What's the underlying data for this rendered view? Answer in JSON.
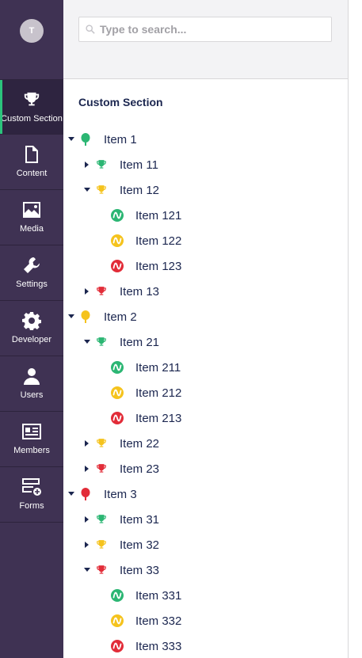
{
  "user": {
    "initial": "T"
  },
  "nav": {
    "items": [
      {
        "label": "Custom Section",
        "icon": "trophy-icon"
      },
      {
        "label": "Content",
        "icon": "document-icon"
      },
      {
        "label": "Media",
        "icon": "image-icon"
      },
      {
        "label": "Settings",
        "icon": "wrench-icon"
      },
      {
        "label": "Developer",
        "icon": "gear-icon"
      },
      {
        "label": "Users",
        "icon": "user-icon"
      },
      {
        "label": "Members",
        "icon": "id-card-icon"
      },
      {
        "label": "Forms",
        "icon": "forms-icon"
      }
    ],
    "active_index": 0
  },
  "search": {
    "placeholder": "Type to search..."
  },
  "section": {
    "title": "Custom Section"
  },
  "colors": {
    "sidebar_bg": "#3f3253",
    "accent": "#2bc37c",
    "green": "#2bb673",
    "yellow": "#f5c31d",
    "red": "#e22c38",
    "text": "#1b264f"
  },
  "tree": [
    {
      "label": "Item 1",
      "level": 0,
      "caret": "down",
      "icon": "tree-icon",
      "color": "green"
    },
    {
      "label": "Item 11",
      "level": 1,
      "caret": "right",
      "icon": "trophy-icon",
      "color": "green"
    },
    {
      "label": "Item 12",
      "level": 1,
      "caret": "down",
      "icon": "trophy-icon",
      "color": "yellow"
    },
    {
      "label": "Item 121",
      "level": 2,
      "caret": "none",
      "icon": "wave-icon",
      "color": "green"
    },
    {
      "label": "Item 122",
      "level": 2,
      "caret": "none",
      "icon": "wave-icon",
      "color": "yellow"
    },
    {
      "label": "Item 123",
      "level": 2,
      "caret": "none",
      "icon": "wave-icon",
      "color": "red"
    },
    {
      "label": "Item 13",
      "level": 1,
      "caret": "right",
      "icon": "trophy-icon",
      "color": "red"
    },
    {
      "label": "Item 2",
      "level": 0,
      "caret": "down",
      "icon": "tree-icon",
      "color": "yellow"
    },
    {
      "label": "Item 21",
      "level": 1,
      "caret": "down",
      "icon": "trophy-icon",
      "color": "green"
    },
    {
      "label": "Item 211",
      "level": 2,
      "caret": "none",
      "icon": "wave-icon",
      "color": "green"
    },
    {
      "label": "Item 212",
      "level": 2,
      "caret": "none",
      "icon": "wave-icon",
      "color": "yellow"
    },
    {
      "label": "Item 213",
      "level": 2,
      "caret": "none",
      "icon": "wave-icon",
      "color": "red"
    },
    {
      "label": "Item 22",
      "level": 1,
      "caret": "right",
      "icon": "trophy-icon",
      "color": "yellow"
    },
    {
      "label": "Item 23",
      "level": 1,
      "caret": "right",
      "icon": "trophy-icon",
      "color": "red"
    },
    {
      "label": "Item 3",
      "level": 0,
      "caret": "down",
      "icon": "tree-icon",
      "color": "red"
    },
    {
      "label": "Item 31",
      "level": 1,
      "caret": "right",
      "icon": "trophy-icon",
      "color": "green"
    },
    {
      "label": "Item 32",
      "level": 1,
      "caret": "right",
      "icon": "trophy-icon",
      "color": "yellow"
    },
    {
      "label": "Item 33",
      "level": 1,
      "caret": "down",
      "icon": "trophy-icon",
      "color": "red"
    },
    {
      "label": "Item 331",
      "level": 2,
      "caret": "none",
      "icon": "wave-icon",
      "color": "green"
    },
    {
      "label": "Item 332",
      "level": 2,
      "caret": "none",
      "icon": "wave-icon",
      "color": "yellow"
    },
    {
      "label": "Item 333",
      "level": 2,
      "caret": "none",
      "icon": "wave-icon",
      "color": "red"
    }
  ]
}
